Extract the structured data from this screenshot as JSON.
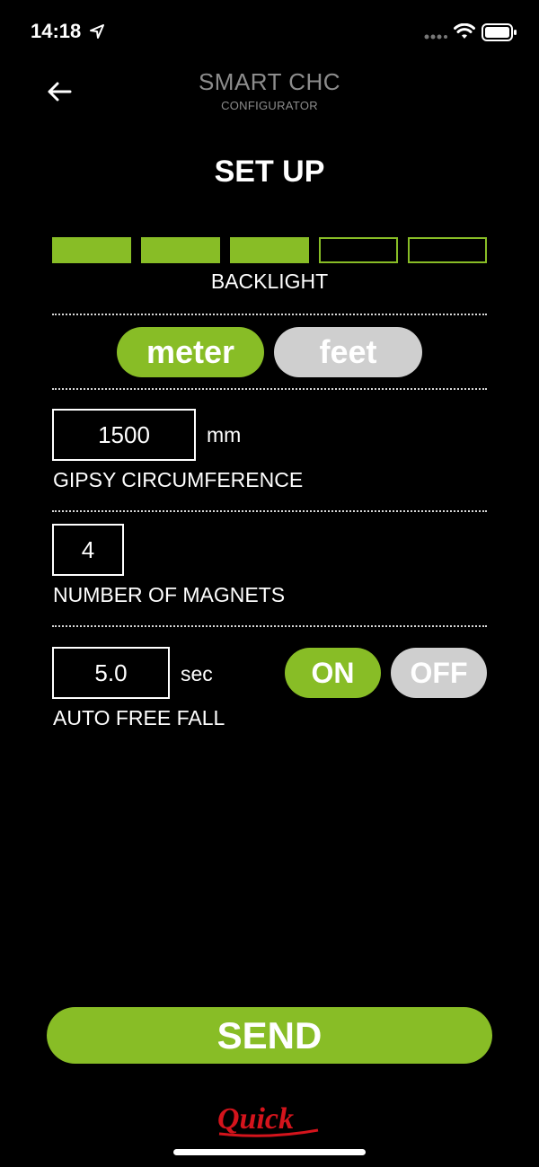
{
  "status": {
    "time": "14:18"
  },
  "header": {
    "app_title": "SMART CHC",
    "app_subtitle": "CONFIGURATOR",
    "page_title": "SET UP"
  },
  "backlight": {
    "label": "BACKLIGHT",
    "level": 3,
    "max": 5
  },
  "units": {
    "meter_label": "meter",
    "feet_label": "feet",
    "selected": "meter"
  },
  "gipsy": {
    "value": "1500",
    "unit": "mm",
    "label": "GIPSY CIRCUMFERENCE"
  },
  "magnets": {
    "value": "4",
    "label": "NUMBER OF MAGNETS"
  },
  "free_fall": {
    "value": "5.0",
    "unit": "sec",
    "label": "AUTO FREE FALL",
    "on_label": "ON",
    "off_label": "OFF",
    "state": "on"
  },
  "send_label": "SEND",
  "brand": {
    "logo_text": "Quick",
    "accent": "#88bd26",
    "logo_color": "#d4141c"
  }
}
